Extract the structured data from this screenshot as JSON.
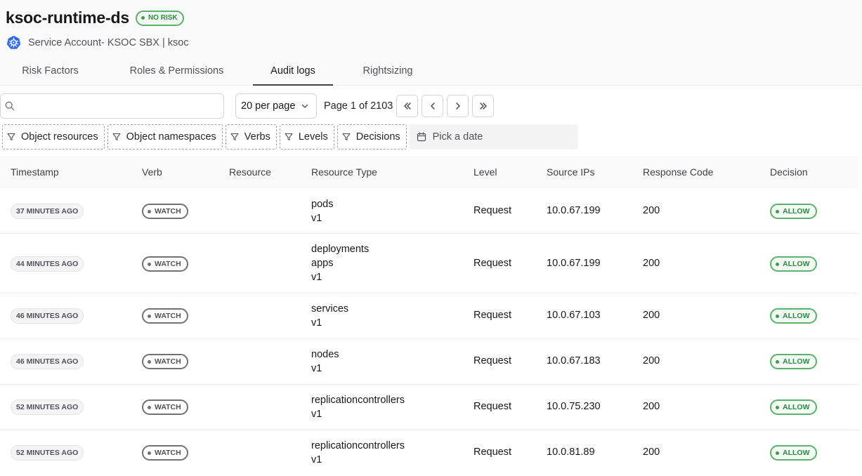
{
  "header": {
    "title": "ksoc-runtime-ds",
    "risk_badge": "NO RISK",
    "subtitle": "Service Account- KSOC SBX | ksoc",
    "icon": "kubernetes-icon"
  },
  "tabs": [
    {
      "label": "Risk Factors",
      "active": false
    },
    {
      "label": "Roles & Permissions",
      "active": false
    },
    {
      "label": "Audit logs",
      "active": true
    },
    {
      "label": "Rightsizing",
      "active": false
    }
  ],
  "toolbar": {
    "search_value": "",
    "per_page": "20 per page",
    "page_info": "Page 1 of 2103",
    "first_label": "«",
    "prev_label": "‹",
    "next_label": "›",
    "last_label": "»"
  },
  "filters": [
    "Object resources",
    "Object namespaces",
    "Verbs",
    "Levels",
    "Decisions"
  ],
  "date_picker": "Pick a date",
  "table": {
    "columns": [
      "Timestamp",
      "Verb",
      "Resource",
      "Resource Type",
      "Level",
      "Source IPs",
      "Response Code",
      "Decision"
    ],
    "rows": [
      {
        "timestamp": "37 MINUTES AGO",
        "verb": "WATCH",
        "resource": "",
        "resource_type": [
          "pods",
          "v1"
        ],
        "level": "Request",
        "source_ip": "10.0.67.199",
        "response_code": "200",
        "decision": "ALLOW"
      },
      {
        "timestamp": "44 MINUTES AGO",
        "verb": "WATCH",
        "resource": "",
        "resource_type": [
          "deployments",
          "apps",
          "v1"
        ],
        "level": "Request",
        "source_ip": "10.0.67.199",
        "response_code": "200",
        "decision": "ALLOW"
      },
      {
        "timestamp": "46 MINUTES AGO",
        "verb": "WATCH",
        "resource": "",
        "resource_type": [
          "services",
          "v1"
        ],
        "level": "Request",
        "source_ip": "10.0.67.103",
        "response_code": "200",
        "decision": "ALLOW"
      },
      {
        "timestamp": "46 MINUTES AGO",
        "verb": "WATCH",
        "resource": "",
        "resource_type": [
          "nodes",
          "v1"
        ],
        "level": "Request",
        "source_ip": "10.0.67.183",
        "response_code": "200",
        "decision": "ALLOW"
      },
      {
        "timestamp": "52 MINUTES AGO",
        "verb": "WATCH",
        "resource": "",
        "resource_type": [
          "replicationcontrollers",
          "v1"
        ],
        "level": "Request",
        "source_ip": "10.0.75.230",
        "response_code": "200",
        "decision": "ALLOW"
      },
      {
        "timestamp": "52 MINUTES AGO",
        "verb": "WATCH",
        "resource": "",
        "resource_type": [
          "replicationcontrollers",
          "v1"
        ],
        "level": "Request",
        "source_ip": "10.0.81.89",
        "response_code": "200",
        "decision": "ALLOW"
      }
    ]
  },
  "colors": {
    "allow_green": "#5cb16d",
    "verb_gray": "#71717a",
    "kubernetes_blue": "#326ce5"
  }
}
